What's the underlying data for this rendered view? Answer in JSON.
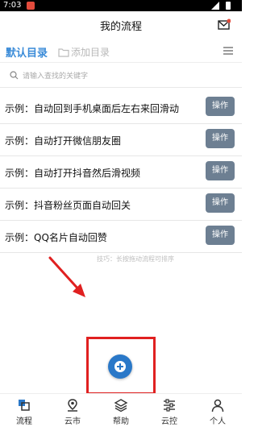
{
  "status_bar": {
    "time": "7:03"
  },
  "header": {
    "title": "我的流程"
  },
  "tabs": {
    "default_label": "默认目录",
    "add_label": "添加目录"
  },
  "search": {
    "placeholder": "请输入查找的关键字"
  },
  "flows": [
    {
      "label": "示例：自动回到手机桌面后左右来回滑动",
      "action": "操作"
    },
    {
      "label": "示例：自动打开微信朋友圈",
      "action": "操作"
    },
    {
      "label": "示例：自动打开抖音然后滑视频",
      "action": "操作"
    },
    {
      "label": "示例：抖音粉丝页面自动回关",
      "action": "操作"
    },
    {
      "label": "示例：QQ名片自动回赞",
      "action": "操作"
    }
  ],
  "tip": "技巧：长按拖动流程可排序",
  "nav": [
    {
      "label": "流程",
      "icon": "flow-icon"
    },
    {
      "label": "云市",
      "icon": "location-icon"
    },
    {
      "label": "帮助",
      "icon": "layers-icon"
    },
    {
      "label": "云控",
      "icon": "sliders-icon"
    },
    {
      "label": "个人",
      "icon": "person-icon"
    }
  ],
  "colors": {
    "accent": "#3a8bd8",
    "action_button": "#6d7f92",
    "fab": "#2a78c8",
    "annotation": "#e02020"
  }
}
